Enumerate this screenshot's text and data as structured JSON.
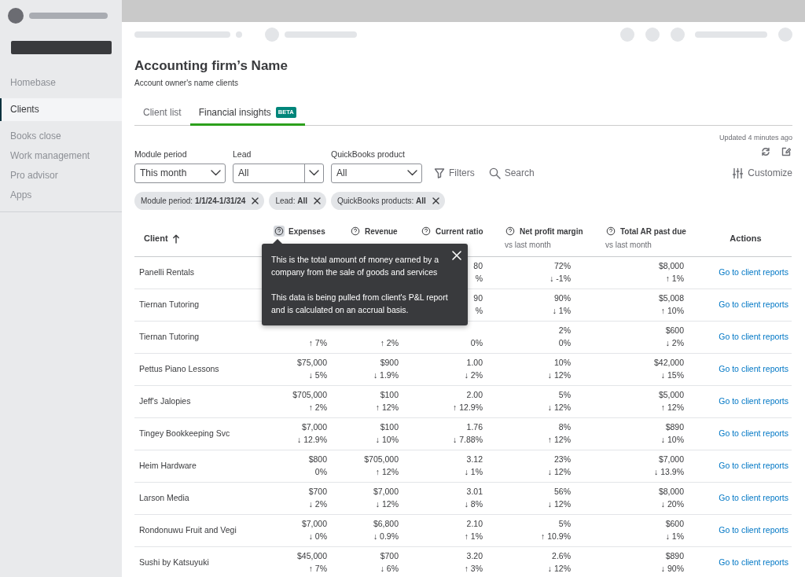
{
  "sidebar": {
    "items": [
      {
        "label": "Homebase",
        "selected": false
      },
      {
        "label": "Clients",
        "selected": true
      },
      {
        "label": "Books close",
        "selected": false
      },
      {
        "label": "Work management",
        "selected": false
      },
      {
        "label": "Pro advisor",
        "selected": false
      },
      {
        "label": "Apps",
        "selected": false
      }
    ]
  },
  "header": {
    "title": "Accounting firm’s Name",
    "subtitle": "Account owner's name clients"
  },
  "tabs": [
    {
      "label": "Client list",
      "selected": false
    },
    {
      "label": "Financial insights",
      "badge": "BETA",
      "selected": true
    }
  ],
  "updated": "Updated 4 minutes ago",
  "filters": [
    {
      "label": "Module period",
      "value": "This month",
      "kind": "select"
    },
    {
      "label": "Lead",
      "value": "All",
      "kind": "split"
    },
    {
      "label": "QuickBooks product",
      "value": "All",
      "kind": "select"
    }
  ],
  "toolbar": {
    "filters": "Filters",
    "search": "Search",
    "customize": "Customize"
  },
  "chips": [
    "Module period: **1/1/24-1/31/24**",
    "Lead: **All**",
    "QuickBooks products: **All**"
  ],
  "table": {
    "columns": [
      {
        "kind": "client",
        "label": "Client"
      },
      {
        "kind": "metric",
        "label": "Expenses",
        "help_active": true
      },
      {
        "kind": "metric",
        "label": "Revenue",
        "help_active": false
      },
      {
        "kind": "metric",
        "label": "Current ratio",
        "help_active": false
      },
      {
        "kind": "metric",
        "label": "Net profit margin",
        "sublabel": "vs last month",
        "help_active": false
      },
      {
        "kind": "metric",
        "label": "Total AR past due",
        "sublabel": "vs last month",
        "help_active": false
      },
      {
        "kind": "action",
        "label": "Actions"
      }
    ],
    "rows": [
      {
        "cells": [
          {
            "text": "Panelli Rentals"
          },
          null,
          null,
          {
            "value": "80",
            "change": "%"
          },
          {
            "value": "72%",
            "change": "↓ -1%"
          },
          {
            "value": "$8,000",
            "change": "↑ 1%"
          },
          {
            "text": "Go to client reports"
          }
        ]
      },
      {
        "cells": [
          {
            "text": "Tiernan Tutoring"
          },
          null,
          null,
          {
            "value": "90",
            "change": "%"
          },
          {
            "value": "90%",
            "change": "↓ 1%"
          },
          {
            "value": "$5,008",
            "change": "↑ 10%"
          },
          {
            "text": "Go to client reports"
          }
        ]
      },
      {
        "cells": [
          {
            "text": "Tiernan Tutoring"
          },
          {
            "change": "↑ 7%"
          },
          {
            "change": "↑ 2%"
          },
          {
            "change": "0%"
          },
          {
            "value": "2%",
            "change": "0%"
          },
          {
            "value": "$600",
            "change": "↓ 2%"
          },
          {
            "text": "Go to client reports"
          }
        ]
      },
      {
        "cells": [
          {
            "text": "Pettus Piano Lessons"
          },
          {
            "value": "$75,000",
            "change": "↓ 5%"
          },
          {
            "value": "$900",
            "change": "↓ 1.9%"
          },
          {
            "value": "1.00",
            "change": "↓ 2%"
          },
          {
            "value": "10%",
            "change": "↓ 12%"
          },
          {
            "value": "$42,000",
            "change": "↓ 15%"
          },
          {
            "text": "Go to client reports"
          }
        ]
      },
      {
        "cells": [
          {
            "text": "Jeff's Jalopies"
          },
          {
            "value": "$705,000",
            "change": "↑ 2%"
          },
          {
            "value": "$100",
            "change": "↑ 12%"
          },
          {
            "value": "2.00",
            "change": "↑ 12.9%"
          },
          {
            "value": "5%",
            "change": "↓ 12%"
          },
          {
            "value": "$5,000",
            "change": "↑ 12%"
          },
          {
            "text": "Go to client reports"
          }
        ]
      },
      {
        "cells": [
          {
            "text": "Tingey Bookkeeping Svc"
          },
          {
            "value": "$7,000",
            "change": "↓ 12.9%"
          },
          {
            "value": "$100",
            "change": "↓ 10%"
          },
          {
            "value": "1.76",
            "change": "↓ 7.88%"
          },
          {
            "value": "8%",
            "change": "↑ 12%"
          },
          {
            "value": "$890",
            "change": "↓ 10%"
          },
          {
            "text": "Go to client reports"
          }
        ]
      },
      {
        "cells": [
          {
            "text": "Heim Hardware"
          },
          {
            "value": "$800",
            "change": "0%"
          },
          {
            "value": "$705,000",
            "change": "↑ 12%"
          },
          {
            "value": "3.12",
            "change": "↓ 1%"
          },
          {
            "value": "23%",
            "change": "↓ 12%"
          },
          {
            "value": "$7,000",
            "change": "↓ 13.9%"
          },
          {
            "text": "Go to client reports"
          }
        ]
      },
      {
        "cells": [
          {
            "text": "Larson Media"
          },
          {
            "value": "$700",
            "change": "↓ 2%"
          },
          {
            "value": "$7,000",
            "change": "↓ 12%"
          },
          {
            "value": "3.01",
            "change": "↓ 8%"
          },
          {
            "value": "56%",
            "change": "↓ 12%"
          },
          {
            "value": "$8,000",
            "change": "↓ 20%"
          },
          {
            "text": "Go to client reports"
          }
        ]
      },
      {
        "cells": [
          {
            "text": "Rondonuwu Fruit and Vegi"
          },
          {
            "value": "$7,000",
            "change": "↓ 0%"
          },
          {
            "value": "$6,800",
            "change": "↓ 0.9%"
          },
          {
            "value": "2.10",
            "change": "↑ 1%"
          },
          {
            "value": "5%",
            "change": "↑ 10.9%"
          },
          {
            "value": "$600",
            "change": "↓ 1%"
          },
          {
            "text": "Go to client reports"
          }
        ]
      },
      {
        "cells": [
          {
            "text": "Sushi by Katsuyuki"
          },
          {
            "value": "$45,000",
            "change": "↑ 7%"
          },
          {
            "value": "$700",
            "change": "↓ 6%"
          },
          {
            "value": "3.20",
            "change": "↑ 3%"
          },
          {
            "value": "2.6%",
            "change": "↓ 12%"
          },
          {
            "value": "$890",
            "change": "↓ 90%"
          },
          {
            "text": "Go to client reports"
          }
        ]
      }
    ]
  },
  "tooltip": {
    "paragraphs": [
      "This is the total amount of money earned by a company from the sale of goods and services",
      "This data is being pulled from client's P&L report and is calculated on an accrual basis."
    ]
  }
}
